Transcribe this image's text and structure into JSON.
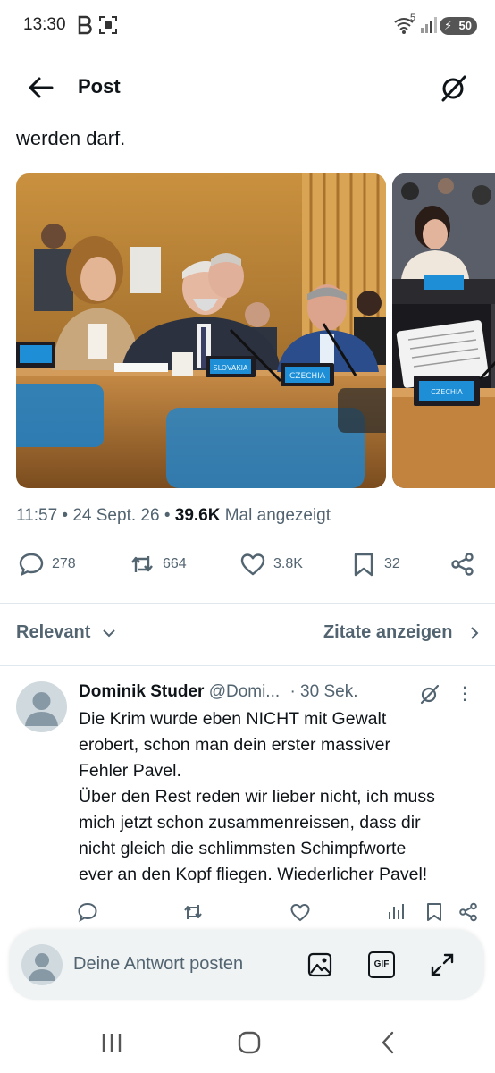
{
  "status": {
    "time": "13:30",
    "battery": "50",
    "network_small": "5"
  },
  "header": {
    "title": "Post"
  },
  "tweet": {
    "text_tail": "werden darf.",
    "meta_time": "11:57 • 24 Sept. 26 • ",
    "views": "39.6K",
    "views_label": " Mal angezeigt",
    "counts": {
      "replies": "278",
      "reposts": "664",
      "likes": "3.8K",
      "bookmarks": "32"
    }
  },
  "sort": {
    "relevant": "Relevant",
    "quotes": "Zitate anzeigen"
  },
  "reply": {
    "name": "Dominik Studer",
    "handle": "@Domi...",
    "time": "· 30 Sek.",
    "lines": [
      "Die Krim wurde eben NICHT mit Gewalt",
      "erobert, schon man dein erster massiver",
      "Fehler Pavel.",
      "Über den Rest reden wir lieber nicht, ich muss",
      "mich jetzt schon zusammenreissen, dass dir",
      "nicht gleich die schlimmsten Schimpfworte",
      "ever an den Kopf fliegen. Wiederlicher Pavel!"
    ]
  },
  "composer": {
    "placeholder": "Deine Antwort posten",
    "gif": "GIF"
  },
  "media": {
    "placards": [
      "SLOVAKIA",
      "CZECHIA",
      "CZECHIA"
    ]
  },
  "colors": {
    "text": "#0f1419",
    "secondary": "#536471",
    "wood": "#b0773a",
    "placard": "#1e8fd6"
  }
}
